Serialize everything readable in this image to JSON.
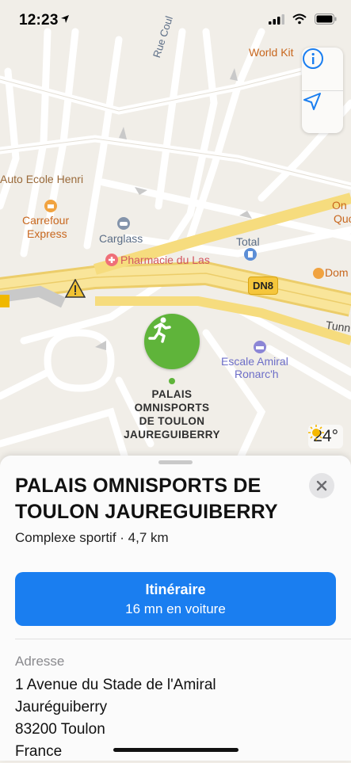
{
  "status_bar": {
    "time": "12:23"
  },
  "map": {
    "labels": {
      "rue": "Rue Coul",
      "world_kit": "World Kit",
      "auto_ecole": "Auto Ecole Henri",
      "carrefour_1": "Carrefour",
      "carrefour_2": "Express",
      "carglass": "Carglass",
      "total": "Total",
      "pharmacie": "Pharmacie du Las",
      "dn8": "DN8",
      "on": "On",
      "quoi": "Quoi",
      "dom": "Dom",
      "tunnel": "Tunn",
      "escale_1": "Escale Amiral",
      "escale_2": "Ronarc'h"
    },
    "pin": {
      "label_lines": [
        "PALAIS",
        "OMNISPORTS",
        "DE TOULON",
        "JAUREGUIBERRY"
      ],
      "color": "#5fb43a"
    },
    "weather": {
      "temperature": "24°"
    }
  },
  "sheet": {
    "title": "PALAIS OMNISPORTS DE TOULON JAUREGUIBERRY",
    "subtitle": "Complexe sportif · 4,7 km",
    "route_button": {
      "title": "Itinéraire",
      "subtitle": "16 mn en voiture",
      "color": "#1a7ef0"
    },
    "address": {
      "label": "Adresse",
      "lines": [
        "1 Avenue du Stade de l'Amiral",
        "Jauréguiberry",
        "83200 Toulon",
        "France"
      ]
    }
  }
}
